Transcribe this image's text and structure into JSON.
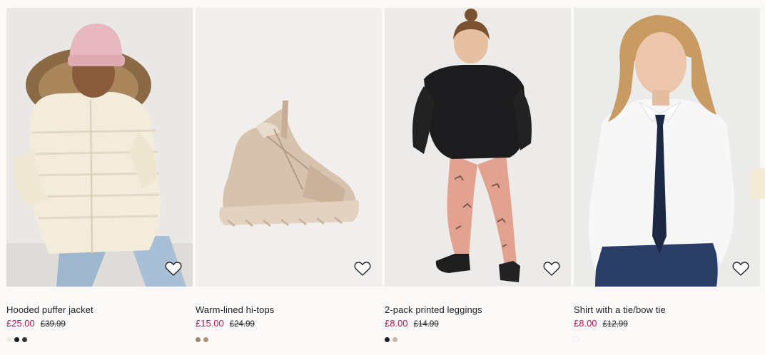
{
  "products": [
    {
      "title": "Hooded puffer jacket",
      "price": "£25.00",
      "old_price": "£39.99",
      "image": "girl-in-cream-puffer-jacket",
      "swatches": [
        "#efe9de",
        "#1d1d1d",
        "#3a3535"
      ]
    },
    {
      "title": "Warm-lined hi-tops",
      "price": "£15.00",
      "old_price": "£24.99",
      "image": "beige-lined-hi-top-boot",
      "swatches": [
        "#a08870",
        "#b39179"
      ]
    },
    {
      "title": "2-pack printed leggings",
      "price": "£8.00",
      "old_price": "£14.99",
      "image": "girl-in-black-jumper-and-pink-leggings",
      "swatches": [
        "#1f1f2a",
        "#c8b7a5"
      ]
    },
    {
      "title": "Shirt with a tie/bow tie",
      "price": "£8.00",
      "old_price": "£12.99",
      "image": "boy-in-white-shirt-and-navy-tie",
      "swatches": [
        "#ffffff"
      ]
    }
  ],
  "icons": {
    "favorite": "heart-outline-icon",
    "next": "carousel-next-arrow"
  },
  "colors": {
    "sale_price": "#b7154a",
    "background": "#faf9f8"
  }
}
